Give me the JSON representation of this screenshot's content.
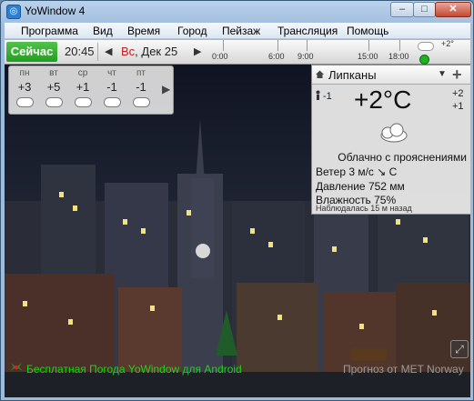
{
  "window": {
    "title": "YoWindow 4",
    "min_glyph": "–",
    "max_glyph": "□",
    "close_glyph": "✕"
  },
  "menu": [
    "Программа",
    "Вид",
    "Время",
    "Город",
    "Пейзаж",
    "Трансляция",
    "Помощь"
  ],
  "timebar": {
    "now_label": "Сейчас",
    "time": "20:45",
    "date_weekday": "Вс",
    "date_rest": ", Дек 25",
    "prev_arrow": "◀",
    "next_arrow": "▶",
    "ticks": [
      "0:00",
      "6:00",
      "9:00",
      "15:00",
      "18:00"
    ],
    "current_temp": "+2°"
  },
  "forecast": {
    "days": [
      {
        "day": "пн",
        "temp": "+3",
        "icon": "rain-cloud-icon"
      },
      {
        "day": "вт",
        "temp": "+5",
        "icon": "cloud-icon"
      },
      {
        "day": "ср",
        "temp": "+1",
        "icon": "cloud-icon"
      },
      {
        "day": "чт",
        "temp": "-1",
        "icon": "cloud-icon"
      },
      {
        "day": "пт",
        "temp": "-1",
        "icon": "cloud-icon"
      }
    ],
    "next_arrow": "▶"
  },
  "weather": {
    "location": "Липканы",
    "dropdown_glyph": "▼",
    "add_glyph": "+",
    "feels_like": "-1",
    "temperature": "+2°C",
    "high": "+2",
    "low": "+1",
    "condition": "Облачно с прояснениями",
    "wind_label": "Ветер",
    "wind_value": "3 м/с ↘ С",
    "pressure_label": "Давление",
    "pressure_value": "752 мм",
    "humidity_label": "Влажность",
    "humidity_value": "75%",
    "observed": "Наблюдалась 15 м назад"
  },
  "bottom": {
    "android_link": "Бесплатная Погода YoWindow для Android",
    "credit": "Прогноз от MET Norway",
    "expand_glyph": "⤢"
  },
  "colors": {
    "now_green": "#2fae2a",
    "android_green": "#19d619",
    "date_red": "#c21d1d"
  }
}
